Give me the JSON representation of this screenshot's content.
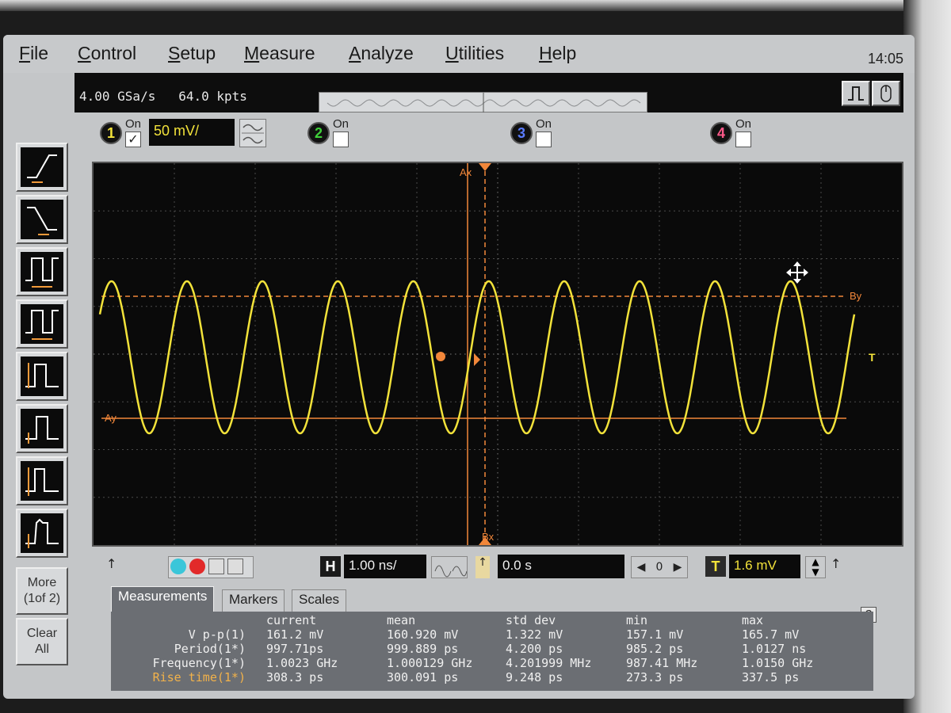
{
  "menu": {
    "items": [
      "File",
      "Control",
      "Setup",
      "Measure",
      "Analyze",
      "Utilities",
      "Help"
    ],
    "clock": "14:05"
  },
  "acquisition": {
    "sample_rate": "4.00 GSa/s",
    "memory_depth": "64.0 kpts"
  },
  "channels": [
    {
      "num": "1",
      "on_label": "On",
      "checked": "✓",
      "scale": "50 mV/",
      "color": "#f2e23a"
    },
    {
      "num": "2",
      "on_label": "On",
      "checked": "",
      "color": "#3fd13a"
    },
    {
      "num": "3",
      "on_label": "On",
      "checked": "",
      "color": "#5a7cff"
    },
    {
      "num": "4",
      "on_label": "On",
      "checked": "",
      "color": "#ff5a8a"
    }
  ],
  "markers": {
    "ax": "Ax",
    "bx": "Bx",
    "ay": "Ay",
    "by": "By",
    "trigger_marker": "T"
  },
  "toolbar": {
    "more_label_1": "More",
    "more_label_2": "(1of 2)",
    "clear_label_1": "Clear",
    "clear_label_2": "All"
  },
  "horizontal": {
    "label": "H",
    "scale": "1.00 ns/",
    "position": "0.0 s",
    "delay_ref": "0"
  },
  "trigger": {
    "label": "T",
    "level": "1.6 mV"
  },
  "tabs": [
    "Measurements",
    "Markers",
    "Scales"
  ],
  "measurements": {
    "headers": [
      "current",
      "mean",
      "std dev",
      "min",
      "max"
    ],
    "rows": [
      {
        "name": "V p-p(1)",
        "current": "161.2 mV",
        "mean": "160.920 mV",
        "std_dev": "1.322 mV",
        "min": "157.1 mV",
        "max": "165.7 mV",
        "color": "#f0f0f0"
      },
      {
        "name": "Period(1*)",
        "current": "997.71ps",
        "mean": "999.889 ps",
        "std_dev": "4.200 ps",
        "min": "985.2 ps",
        "max": "1.0127 ns",
        "color": "#f0f0f0"
      },
      {
        "name": "Frequency(1*)",
        "current": "1.0023 GHz",
        "mean": "1.000129 GHz",
        "std_dev": "4.201999 MHz",
        "min": "987.41 MHz",
        "max": "1.0150 GHz",
        "color": "#f0f0f0"
      },
      {
        "name": "Rise time(1*)",
        "current": "308.3 ps",
        "mean": "300.091 ps",
        "std_dev": "9.248 ps",
        "min": "273.3 ps",
        "max": "337.5 ps",
        "color": "#f2b24a"
      }
    ]
  },
  "waveform": {
    "color": "#f2e23a",
    "cycles_visible": 10,
    "amplitude_mv": 80.5
  },
  "help_label": "?"
}
